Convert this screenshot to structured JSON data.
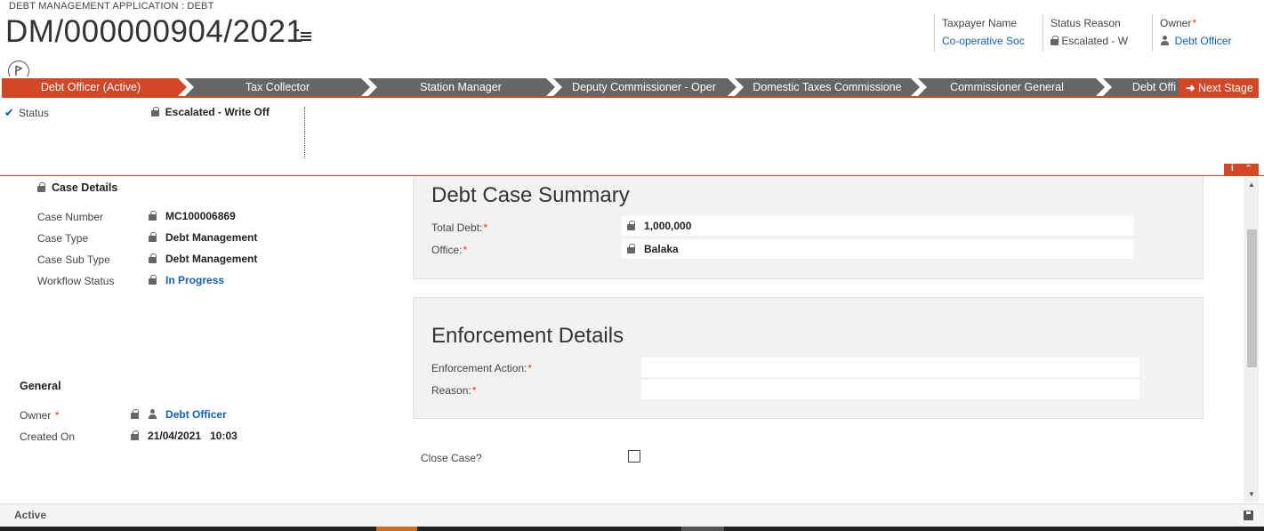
{
  "header": {
    "app_title": "DEBT MANAGEMENT APPLICATION : DEBT",
    "record_title": "DM/000000904/2021",
    "fields": [
      {
        "label": "Taxpayer Name",
        "value": "Co-operative Soc"
      },
      {
        "label": "Status Reason",
        "value": "Escalated - W"
      },
      {
        "label": "Owner",
        "value": "Debt Officer"
      }
    ],
    "required_mark": "*",
    "menu_icon": "hamburger-icon"
  },
  "process": {
    "stages": [
      {
        "label": "Debt Officer (Active)",
        "state": "active"
      },
      {
        "label": "Tax Collector",
        "state": "inactive"
      },
      {
        "label": "Station Manager",
        "state": "inactive"
      },
      {
        "label": "Deputy Commissioner - Oper",
        "state": "inactive"
      },
      {
        "label": "Domestic Taxes Commissione",
        "state": "inactive"
      },
      {
        "label": "Commissioner General",
        "state": "inactive"
      },
      {
        "label": "Debt Offi",
        "state": "inactive"
      }
    ],
    "next_stage_label": "Next Stage",
    "status_label": "Status",
    "status_value": "Escalated - Write Off",
    "accent_color": "#d24726"
  },
  "case_details": {
    "heading": "Case Details",
    "fields": [
      {
        "label": "Case Number",
        "value": "MC100006869"
      },
      {
        "label": "Case Type",
        "value": "Debt Management"
      },
      {
        "label": "Case Sub Type",
        "value": "Debt Management"
      },
      {
        "label": "Workflow Status",
        "value": "In Progress"
      }
    ]
  },
  "general": {
    "heading": "General",
    "owner_label": "Owner",
    "owner_value": "Debt Officer",
    "created_label": "Created On",
    "created_date": "21/04/2021",
    "created_time": "10:03"
  },
  "summary": {
    "title": "Debt Case Summary",
    "total_debt_label": "Total Debt:",
    "total_debt_value": "1,000,000",
    "office_label": "Office:",
    "office_value": "Balaka"
  },
  "enforcement": {
    "title": "Enforcement Details",
    "action_label": "Enforcement Action:",
    "action_value": "",
    "reason_label": "Reason:",
    "reason_value": ""
  },
  "close_case": {
    "label": "Close Case?",
    "checked": false
  },
  "footer": {
    "status": "Active"
  }
}
